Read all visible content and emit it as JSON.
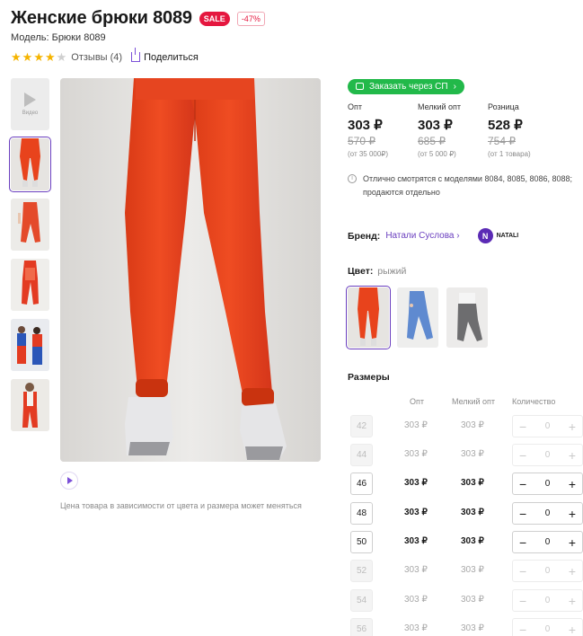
{
  "product": {
    "title": "Женские брюки 8089",
    "badge_sale": "SALE",
    "badge_discount": "-47%",
    "model": "Модель: Брюки 8089",
    "rating": 4,
    "rating_max": 5,
    "reviews": "Отзывы (4)",
    "share": "Поделиться"
  },
  "gallery": {
    "video_label": "Видео",
    "price_note": "Цена товара в зависимости от цвета и размера может меняться"
  },
  "order": {
    "sp_button": "Заказать через СП",
    "prices": [
      {
        "label": "Опт",
        "price": "303 ₽",
        "old": "570 ₽",
        "note": "(от 35 000₽)"
      },
      {
        "label": "Мелкий опт",
        "price": "303 ₽",
        "old": "685 ₽",
        "note": "(от 5 000 ₽)"
      },
      {
        "label": "Розница",
        "price": "528 ₽",
        "old": "754 ₽",
        "note": "(от 1 товара)"
      }
    ],
    "info": "Отлично смотрятся с моделями 8084, 8085, 8086, 8088; продаются отдельно"
  },
  "brand": {
    "label": "Бренд:",
    "name": "Натали Суслова",
    "logo_text": "NATALI",
    "logo_letter": "N"
  },
  "color": {
    "label": "Цвет:",
    "value": "рыжий"
  },
  "sizes": {
    "title": "Размеры",
    "col_opt": "Опт",
    "col_small": "Мелкий опт",
    "col_qty": "Количество",
    "rows": [
      {
        "size": "42",
        "opt": "303 ₽",
        "small": "303 ₽",
        "qty": "0",
        "available": false
      },
      {
        "size": "44",
        "opt": "303 ₽",
        "small": "303 ₽",
        "qty": "0",
        "available": false
      },
      {
        "size": "46",
        "opt": "303 ₽",
        "small": "303 ₽",
        "qty": "0",
        "available": true
      },
      {
        "size": "48",
        "opt": "303 ₽",
        "small": "303 ₽",
        "qty": "0",
        "available": true
      },
      {
        "size": "50",
        "opt": "303 ₽",
        "small": "303 ₽",
        "qty": "0",
        "available": true
      },
      {
        "size": "52",
        "opt": "303 ₽",
        "small": "303 ₽",
        "qty": "0",
        "available": false
      },
      {
        "size": "54",
        "opt": "303 ₽",
        "small": "303 ₽",
        "qty": "0",
        "available": false
      },
      {
        "size": "56",
        "opt": "303 ₽",
        "small": "303 ₽",
        "qty": "0",
        "available": false
      }
    ]
  },
  "colors": {
    "accent": "#6a3fbf",
    "sale": "#e5173f",
    "sp_green": "#22b94a",
    "product_orange": "#e8431c"
  }
}
